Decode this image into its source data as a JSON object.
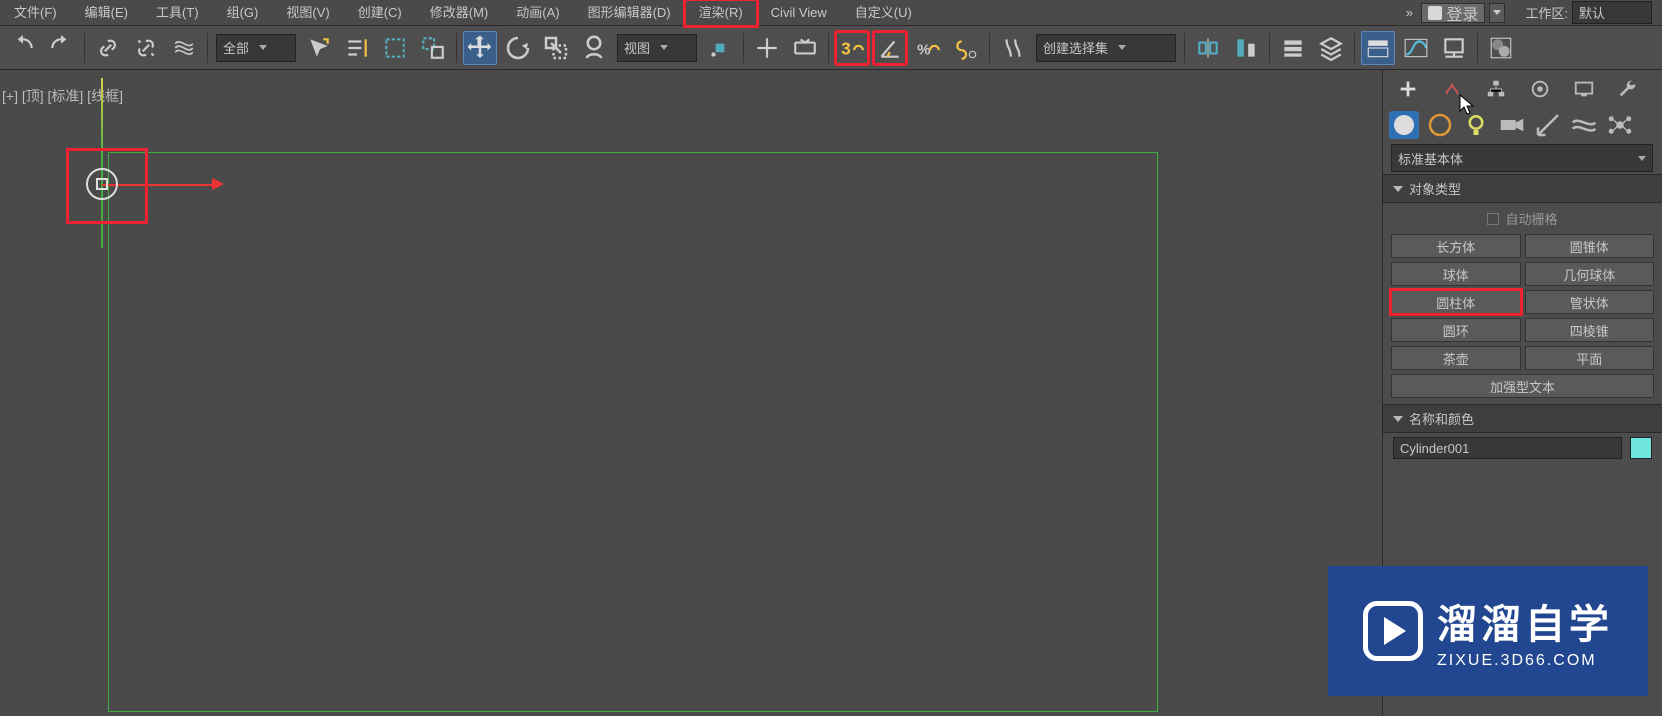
{
  "menu": {
    "file": "文件(F)",
    "edit": "编辑(E)",
    "tools": "工具(T)",
    "group": "组(G)",
    "views": "视图(V)",
    "create": "创建(C)",
    "modifiers": "修改器(M)",
    "animation": "动画(A)",
    "grapheditors": "图形编辑器(D)",
    "rendering": "渲染(R)",
    "civilview": "Civil View",
    "customize": "自定义(U)",
    "more": "»",
    "signin": "登录",
    "workspace_label": "工作区:",
    "workspace_value": "默认"
  },
  "toolbar": {
    "selfilter": "全部",
    "refcoord": "视图",
    "selset": "创建选择集"
  },
  "viewport": {
    "label": "[+] [顶] [标准] [线框]"
  },
  "panel": {
    "primdd": "标准基本体",
    "rollout_objtype": "对象类型",
    "autogrid": "自动栅格",
    "buttons": {
      "box": "长方体",
      "cone": "圆锥体",
      "sphere": "球体",
      "geosphere": "几何球体",
      "cylinder": "圆柱体",
      "tube": "管状体",
      "torus": "圆环",
      "pyramid": "四棱锥",
      "teapot": "茶壶",
      "plane": "平面",
      "textplus": "加强型文本"
    },
    "rollout_namecolor": "名称和颜色",
    "name_value": "Cylinder001"
  },
  "watermark": {
    "t1": "溜溜自学",
    "t2": "ZIXUE.3D66.COM"
  }
}
